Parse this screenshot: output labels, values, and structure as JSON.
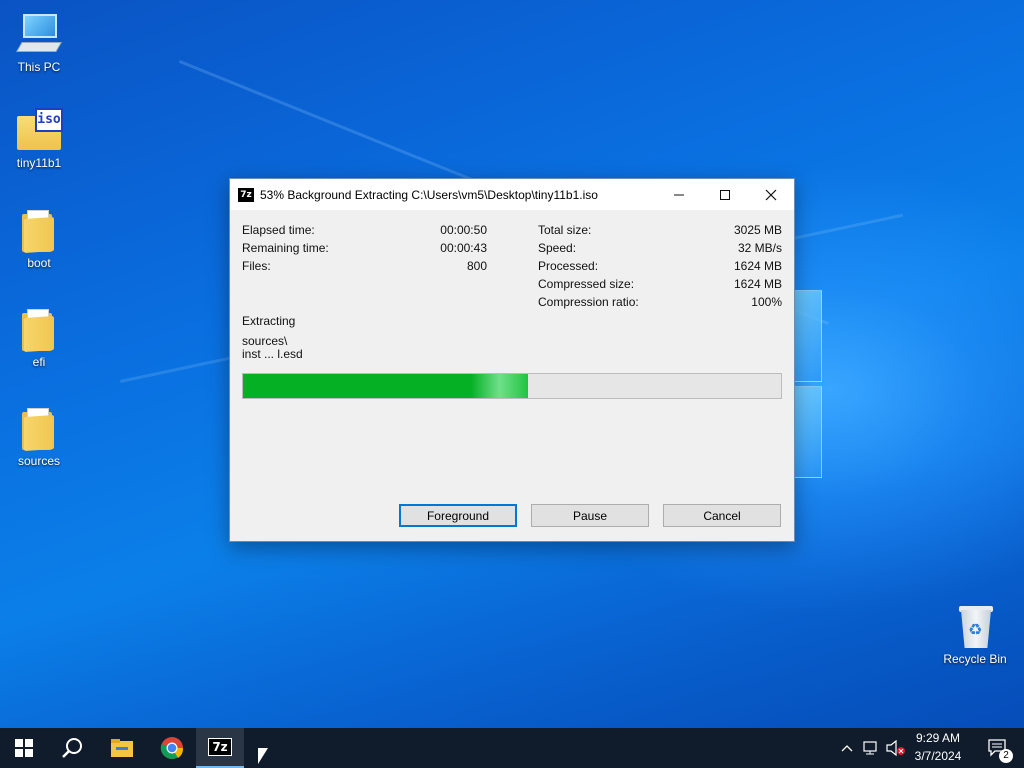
{
  "desktop": {
    "icons": [
      {
        "label": "This PC",
        "icon": "this-pc-icon"
      },
      {
        "label": "tiny11b1",
        "icon": "iso-file-icon",
        "badge": "iso"
      },
      {
        "label": "boot",
        "icon": "folder-icon"
      },
      {
        "label": "efi",
        "icon": "folder-icon"
      },
      {
        "label": "sources",
        "icon": "folder-icon"
      },
      {
        "label": "Recycle Bin",
        "icon": "recycle-bin-icon"
      }
    ]
  },
  "dialog": {
    "app_icon_text": "7z",
    "title": "53% Background Extracting C:\\Users\\vm5\\Desktop\\tiny11b1.iso",
    "stats_left": [
      {
        "label": "Elapsed time:",
        "value": "00:00:50"
      },
      {
        "label": "Remaining time:",
        "value": "00:00:43"
      },
      {
        "label": "Files:",
        "value": "800"
      }
    ],
    "stats_right": [
      {
        "label": "Total size:",
        "value": "3025 MB"
      },
      {
        "label": "Speed:",
        "value": "32 MB/s"
      },
      {
        "label": "Processed:",
        "value": "1624 MB"
      },
      {
        "label": "Compressed size:",
        "value": "1624 MB"
      },
      {
        "label": "Compression ratio:",
        "value": "100%"
      }
    ],
    "operation": "Extracting",
    "current_path": "sources\\",
    "current_file": "inst ... l.esd",
    "progress_percent": 53,
    "buttons": {
      "foreground": "Foreground",
      "pause": "Pause",
      "cancel": "Cancel"
    }
  },
  "taskbar": {
    "items": [
      "start-icon",
      "search-icon",
      "file-explorer-icon",
      "chrome-icon",
      "7zip-icon"
    ],
    "active_item_text": "7z",
    "clock_time": "9:29 AM",
    "clock_date": "3/7/2024",
    "notification_count": "2"
  },
  "colors": {
    "progress": "#06b025",
    "accent": "#0078d7",
    "taskbar": "#101c2b"
  }
}
